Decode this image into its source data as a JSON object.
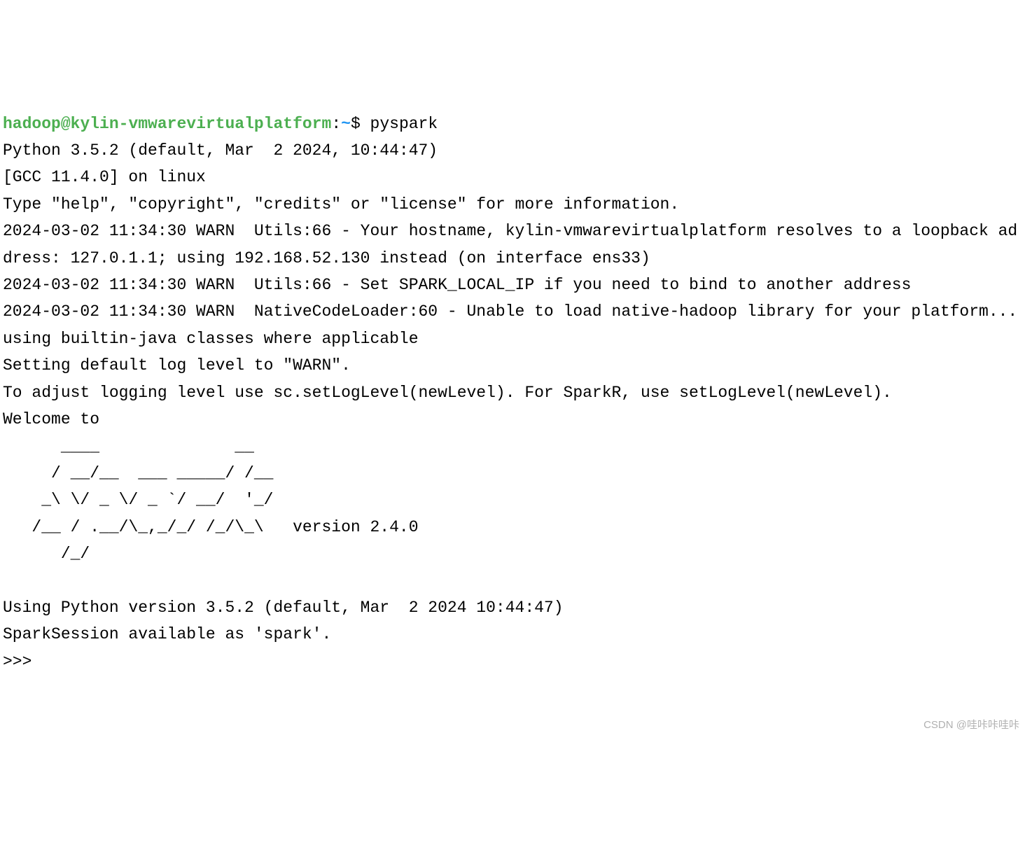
{
  "prompt": {
    "user": "hadoop",
    "at": "@",
    "host": "kylin-vmwarevirtualplatform",
    "colon": ":",
    "path": "~",
    "dollar": "$ "
  },
  "command": "pyspark",
  "lines": {
    "l1": "Python 3.5.2 (default, Mar  2 2024, 10:44:47)",
    "l2": "[GCC 11.4.0] on linux",
    "l3": "Type \"help\", \"copyright\", \"credits\" or \"license\" for more information.",
    "l4": "2024-03-02 11:34:30 WARN  Utils:66 - Your hostname, kylin-vmwarevirtualplatform resolves to a loopback address: 127.0.1.1; using 192.168.52.130 instead (on interface ens33)",
    "l5": "2024-03-02 11:34:30 WARN  Utils:66 - Set SPARK_LOCAL_IP if you need to bind to another address",
    "l6": "2024-03-02 11:34:30 WARN  NativeCodeLoader:60 - Unable to load native-hadoop library for your platform... using builtin-java classes where applicable",
    "l7": "Setting default log level to \"WARN\".",
    "l8": "To adjust logging level use sc.setLogLevel(newLevel). For SparkR, use setLogLevel(newLevel).",
    "l9": "Welcome to",
    "art1": "      ____              __",
    "art2": "     / __/__  ___ _____/ /__",
    "art3": "    _\\ \\/ _ \\/ _ `/ __/  '_/",
    "art4": "   /__ / .__/\\_,_/_/ /_/\\_\\   version 2.4.0",
    "art5": "      /_/",
    "l10": "Using Python version 3.5.2 (default, Mar  2 2024 10:44:47)",
    "l11": "SparkSession available as 'spark'.",
    "l12": ">>> "
  },
  "watermark": "CSDN @哇咔咔哇咔"
}
